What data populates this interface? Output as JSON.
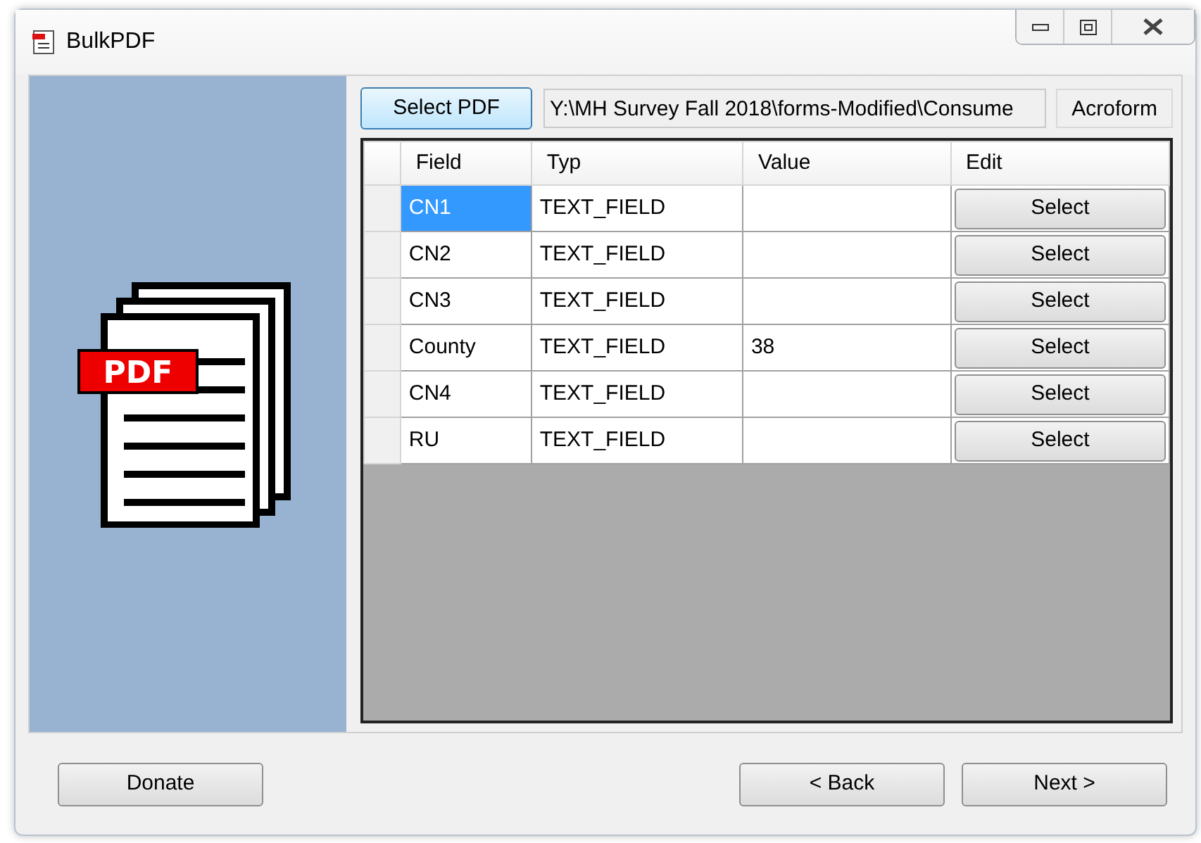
{
  "window": {
    "title": "BulkPDF"
  },
  "logo": {
    "label": "PDF"
  },
  "toolbar": {
    "select_button": "Select PDF",
    "path": "Y:\\MH Survey Fall 2018\\forms-Modified\\Consume",
    "form_type": "Acroform"
  },
  "table": {
    "columns": [
      "Field",
      "Typ",
      "Value",
      "Edit"
    ],
    "rows": [
      {
        "field": "CN1",
        "type": "TEXT_FIELD",
        "value": "",
        "edit": "Select",
        "selected": true
      },
      {
        "field": "CN2",
        "type": "TEXT_FIELD",
        "value": "",
        "edit": "Select",
        "selected": false
      },
      {
        "field": "CN3",
        "type": "TEXT_FIELD",
        "value": "",
        "edit": "Select",
        "selected": false
      },
      {
        "field": "County",
        "type": "TEXT_FIELD",
        "value": "38",
        "edit": "Select",
        "selected": false
      },
      {
        "field": "CN4",
        "type": "TEXT_FIELD",
        "value": "",
        "edit": "Select",
        "selected": false
      },
      {
        "field": "RU",
        "type": "TEXT_FIELD",
        "value": "",
        "edit": "Select",
        "selected": false
      }
    ]
  },
  "footer": {
    "donate": "Donate",
    "back": "< Back",
    "next": "Next >"
  }
}
